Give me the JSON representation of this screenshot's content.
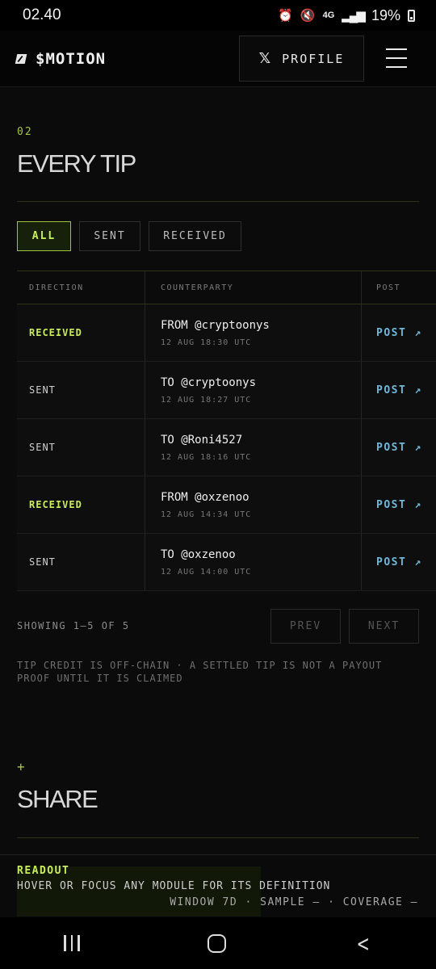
{
  "status_bar": {
    "time": "02.40",
    "network": "4G",
    "battery": "19%",
    "icons": [
      "alarm-icon",
      "mute-icon",
      "network-4g-icon",
      "signal-icon",
      "battery-icon"
    ]
  },
  "header": {
    "logo_text": "$MOTION",
    "profile_label": "PROFILE",
    "profile_icon": "x-logo-icon",
    "menu_icon": "hamburger-menu-icon"
  },
  "section": {
    "number": "02",
    "title": "EVERY TIP"
  },
  "filters": [
    {
      "label": "ALL",
      "active": true
    },
    {
      "label": "SENT",
      "active": false
    },
    {
      "label": "RECEIVED",
      "active": false
    }
  ],
  "table": {
    "columns": [
      "DIRECTION",
      "COUNTERPARTY",
      "POST"
    ],
    "rows": [
      {
        "direction": "RECEIVED",
        "counterparty": "FROM @cryptoonys",
        "time": "12 AUG 18:30 UTC",
        "post": "POST",
        "arrow": "↗"
      },
      {
        "direction": "SENT",
        "counterparty": "TO @cryptoonys",
        "time": "12 AUG 18:27 UTC",
        "post": "POST",
        "arrow": "↗"
      },
      {
        "direction": "SENT",
        "counterparty": "TO @Roni4527",
        "time": "12 AUG 18:16 UTC",
        "post": "POST",
        "arrow": "↗"
      },
      {
        "direction": "RECEIVED",
        "counterparty": "FROM @oxzenoo",
        "time": "12 AUG 14:34 UTC",
        "post": "POST",
        "arrow": "↗"
      },
      {
        "direction": "SENT",
        "counterparty": "TO @oxzenoo",
        "time": "12 AUG 14:00 UTC",
        "post": "POST",
        "arrow": "↗"
      }
    ]
  },
  "pagination": {
    "showing": "SHOWING 1–5 OF 5",
    "prev": "PREV",
    "next": "NEXT"
  },
  "note": "TIP CREDIT IS OFF-CHAIN · A SETTLED TIP IS NOT A PAYOUT PROOF UNTIL IT IS CLAIMED",
  "share": {
    "marker": "+",
    "title": "SHARE"
  },
  "readout": {
    "label": "READOUT",
    "text": "HOVER OR FOCUS ANY MODULE FOR ITS DEFINITION",
    "meta": "WINDOW 7D · SAMPLE — · COVERAGE —"
  },
  "colors": {
    "accent": "#c8ec5c",
    "link": "#6fb7d8",
    "background": "#0b0b0b"
  }
}
